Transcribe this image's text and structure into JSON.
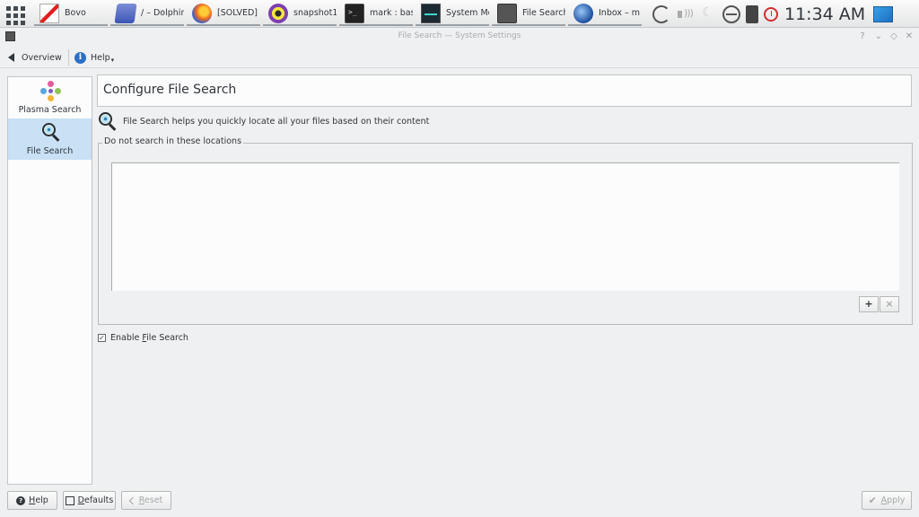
{
  "taskbar": {
    "tasks": [
      {
        "label": "Bovo",
        "icon": "bovo-icon"
      },
      {
        "label": "/ – Dolphin",
        "icon": "dolphin-icon"
      },
      {
        "label": "[SOLVED] ",
        "icon": "firefox-icon"
      },
      {
        "label": "snapshot1",
        "icon": "snapshot-icon"
      },
      {
        "label": "mark : bash",
        "icon": "terminal-icon"
      },
      {
        "label": "System Monitor",
        "icon": "system-monitor-icon"
      },
      {
        "label": "File Search",
        "icon": "file-search-icon"
      },
      {
        "label": "Inbox – m",
        "icon": "thunderbird-icon"
      }
    ],
    "clock": "11:34 AM"
  },
  "window": {
    "title": "File Search  — System Settings"
  },
  "toolbar": {
    "overview_label": "Overview",
    "help_label": "Help"
  },
  "sidebar": {
    "items": [
      {
        "label": "Plasma Search",
        "icon": "plasma-search-icon",
        "active": false
      },
      {
        "label": "File Search",
        "icon": "file-search-icon",
        "active": true
      }
    ]
  },
  "main": {
    "title": "Configure File Search",
    "description": "File Search helps you quickly locate all your files based on their content",
    "exclude_group_label": "Do not search in these locations",
    "excluded_locations": [],
    "add_button": "+",
    "remove_button": "×",
    "enable_checkbox": {
      "label_prefix": "Enable ",
      "label_mnemonic": "F",
      "label_rest": "ile Search",
      "checked": true
    }
  },
  "buttons": {
    "help": {
      "mnemonic": "H",
      "rest": "elp"
    },
    "defaults": {
      "mnemonic": "D",
      "rest": "efaults"
    },
    "reset": {
      "mnemonic": "R",
      "rest": "eset"
    },
    "apply": {
      "mnemonic": "A",
      "rest": "pply"
    }
  }
}
